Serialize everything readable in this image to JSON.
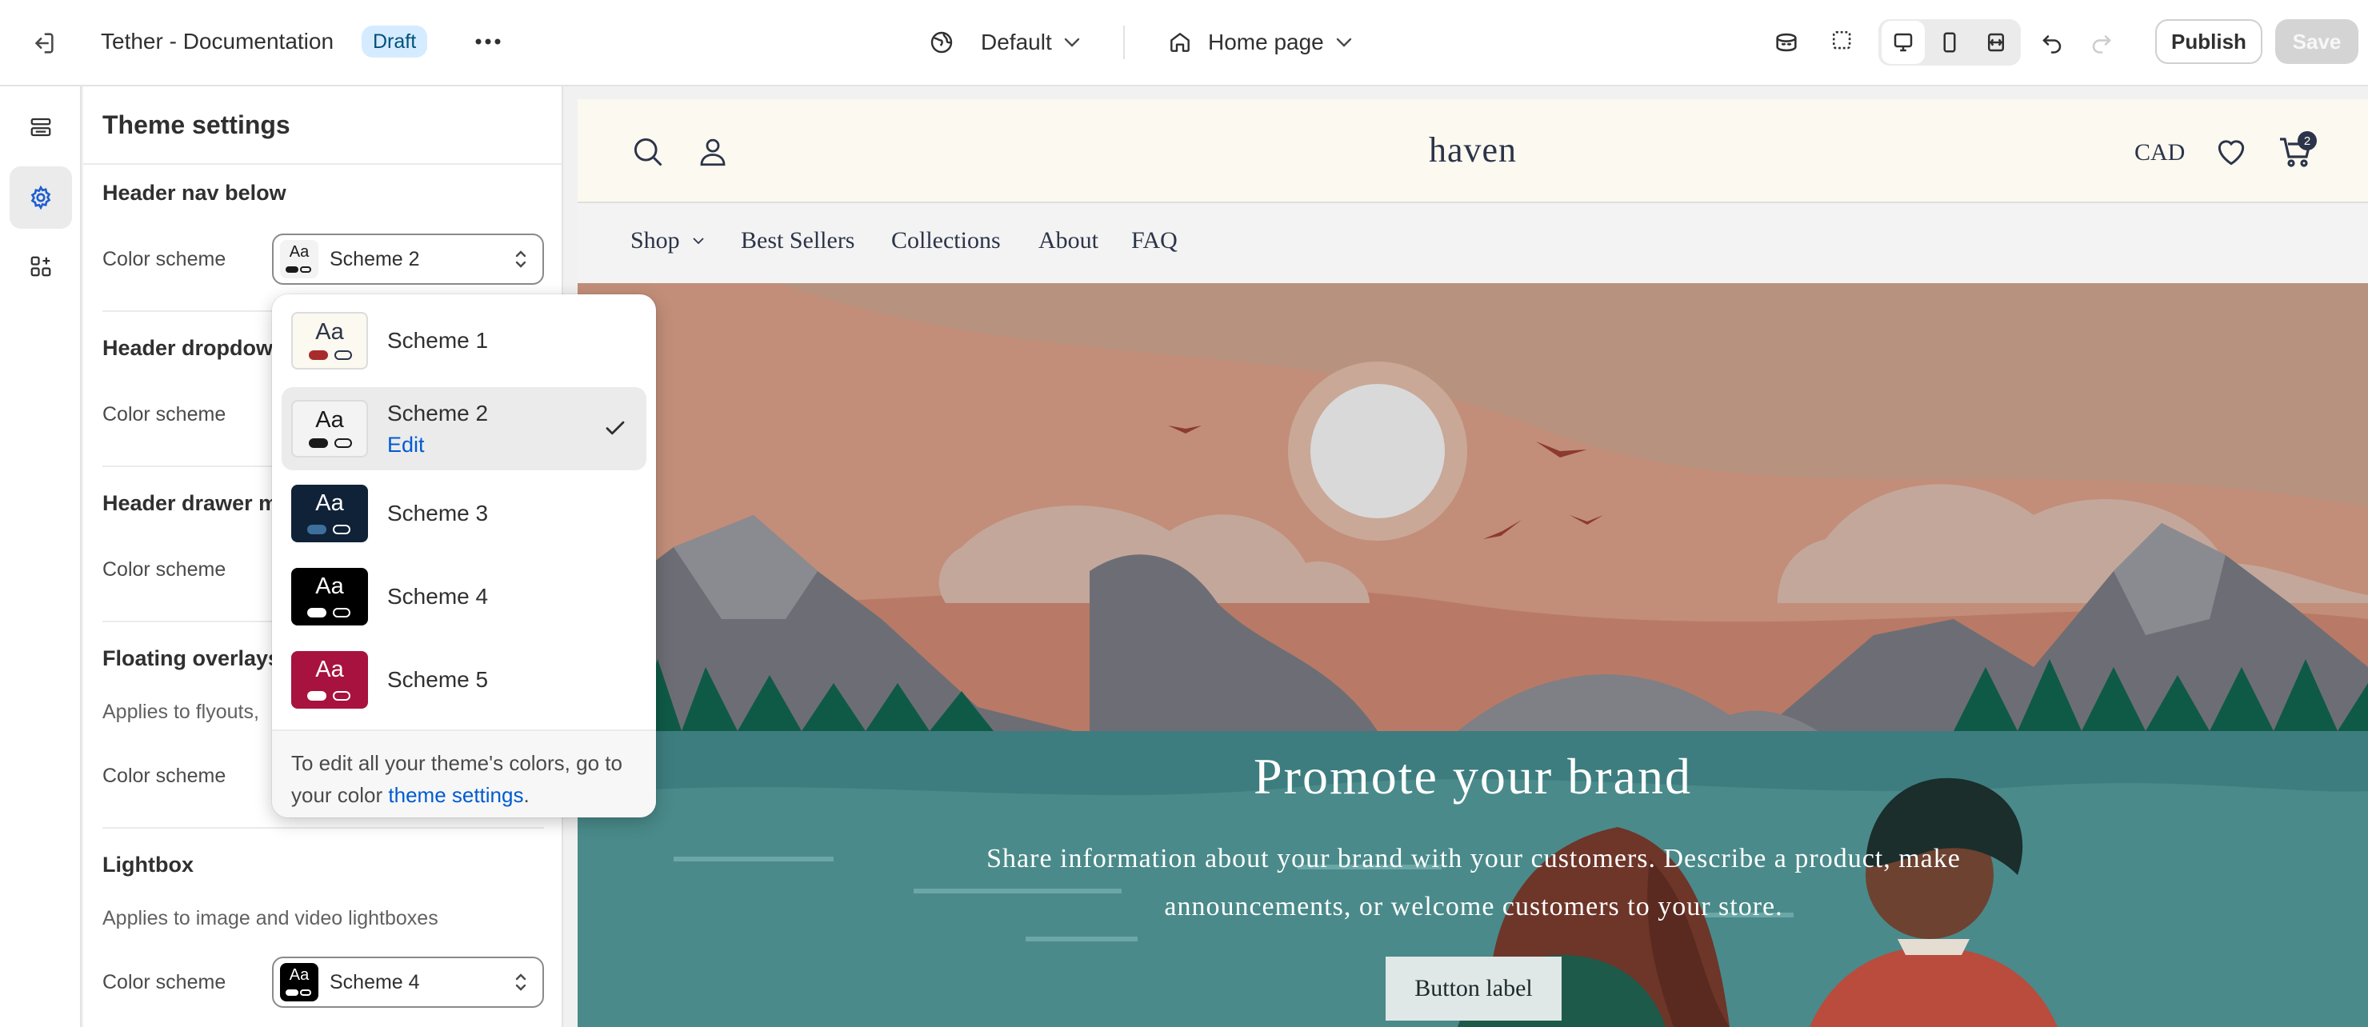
{
  "topbar": {
    "store_name": "Tether - Documentation",
    "draft_badge": "Draft",
    "theme_select": "Default",
    "page_select": "Home page",
    "publish_label": "Publish",
    "save_label": "Save"
  },
  "rail": {
    "items": [
      {
        "icon": "sections-icon",
        "active": false
      },
      {
        "icon": "gear-icon",
        "active": true
      },
      {
        "icon": "apps-icon",
        "active": false
      }
    ]
  },
  "panel": {
    "title": "Theme settings",
    "sections": [
      {
        "title": "Header nav below",
        "row_label": "Color scheme",
        "value": "Scheme 2"
      },
      {
        "title": "Header dropdow",
        "row_label": "Color scheme"
      },
      {
        "title": "Header drawer m",
        "row_label": "Color scheme"
      },
      {
        "title": "Floating overlays",
        "subtitle": "Applies to flyouts,",
        "row_label": "Color scheme"
      },
      {
        "title": "Lightbox",
        "subtitle": "Applies to image and video lightboxes",
        "row_label": "Color scheme",
        "value": "Scheme 4"
      }
    ]
  },
  "dropdown": {
    "options": [
      {
        "label": "Scheme 1",
        "bg": "#fbf9f0",
        "text": "#2c3449",
        "accent": "#a82c2c",
        "border": "#dcdcdc"
      },
      {
        "label": "Scheme 2",
        "edit": "Edit",
        "bg": "#f3f3f3",
        "text": "#1a1a1a",
        "accent": "#1a1a1a",
        "border": "#dcdcdc"
      },
      {
        "label": "Scheme 3",
        "bg": "#0f2238",
        "text": "#ffffff",
        "accent": "#3d6f9c",
        "border": "#0f2238"
      },
      {
        "label": "Scheme 4",
        "bg": "#000000",
        "text": "#ffffff",
        "accent": "#ffffff",
        "border": "#000000"
      },
      {
        "label": "Scheme 5",
        "bg": "#a8123e",
        "text": "#ffffff",
        "accent": "#ffffff",
        "border": "#a8123e"
      }
    ],
    "footer_text": "To edit all your theme's colors, go to your color ",
    "footer_link": "theme settings",
    "footer_end": "."
  },
  "preview": {
    "logo": "haven",
    "currency": "CAD",
    "cart_count": "2",
    "nav": [
      "Shop",
      "Best Sellers",
      "Collections",
      "About",
      "FAQ"
    ],
    "hero_title": "Promote your brand",
    "hero_text": "Share information about your brand with your customers. Describe a product, make announcements, or welcome customers to your store.",
    "hero_button": "Button label"
  }
}
